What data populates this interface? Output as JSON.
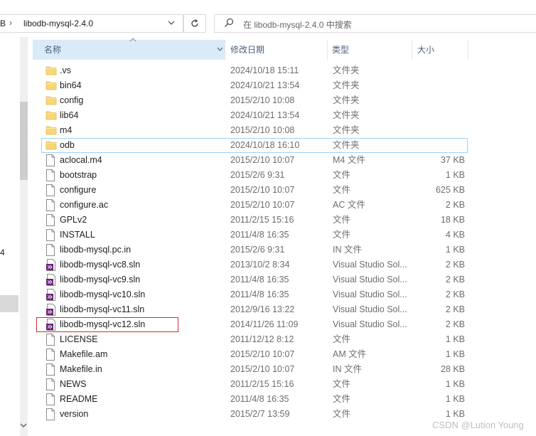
{
  "address": {
    "prev_crumb": "B",
    "separator": "›",
    "current_folder": "libodb-mysql-2.4.0",
    "dropdown_icon": "chevron-down-icon",
    "refresh_icon": "refresh-icon"
  },
  "search": {
    "placeholder": "在 libodb-mysql-2.4.0 中搜索",
    "icon": "search-icon"
  },
  "nav": {
    "partial_label": "4"
  },
  "columns": {
    "name": "名称",
    "date": "修改日期",
    "type": "类型",
    "size": "大小"
  },
  "colors": {
    "header_bg": "#d9ebf9",
    "folder": "#f8d775",
    "focus_border": "#99d1ff",
    "highlight_box": "#d62d2d"
  },
  "files": [
    {
      "name": ".vs",
      "date": "2024/10/18 15:11",
      "type": "文件夹",
      "size": "",
      "icon": "folder-icon"
    },
    {
      "name": "bin64",
      "date": "2024/10/21 13:54",
      "type": "文件夹",
      "size": "",
      "icon": "folder-icon"
    },
    {
      "name": "config",
      "date": "2015/2/10 10:08",
      "type": "文件夹",
      "size": "",
      "icon": "folder-icon"
    },
    {
      "name": "lib64",
      "date": "2024/10/21 13:54",
      "type": "文件夹",
      "size": "",
      "icon": "folder-icon"
    },
    {
      "name": "m4",
      "date": "2015/2/10 10:08",
      "type": "文件夹",
      "size": "",
      "icon": "folder-icon"
    },
    {
      "name": "odb",
      "date": "2024/10/18 16:10",
      "type": "文件夹",
      "size": "",
      "icon": "folder-icon",
      "focused": true
    },
    {
      "name": "aclocal.m4",
      "date": "2015/2/10 10:07",
      "type": "M4 文件",
      "size": "37 KB",
      "icon": "file-icon"
    },
    {
      "name": "bootstrap",
      "date": "2015/2/6 9:31",
      "type": "文件",
      "size": "1 KB",
      "icon": "file-icon"
    },
    {
      "name": "configure",
      "date": "2015/2/10 10:07",
      "type": "文件",
      "size": "625 KB",
      "icon": "file-icon"
    },
    {
      "name": "configure.ac",
      "date": "2015/2/10 10:07",
      "type": "AC 文件",
      "size": "2 KB",
      "icon": "file-icon"
    },
    {
      "name": "GPLv2",
      "date": "2011/2/15 15:16",
      "type": "文件",
      "size": "18 KB",
      "icon": "file-icon"
    },
    {
      "name": "INSTALL",
      "date": "2011/4/8 16:35",
      "type": "文件",
      "size": "4 KB",
      "icon": "file-icon"
    },
    {
      "name": "libodb-mysql.pc.in",
      "date": "2015/2/6 9:31",
      "type": "IN 文件",
      "size": "1 KB",
      "icon": "file-icon"
    },
    {
      "name": "libodb-mysql-vc8.sln",
      "date": "2013/10/2 8:34",
      "type": "Visual Studio Sol...",
      "size": "2 KB",
      "icon": "vs-sln-icon"
    },
    {
      "name": "libodb-mysql-vc9.sln",
      "date": "2011/4/8 16:35",
      "type": "Visual Studio Sol...",
      "size": "2 KB",
      "icon": "vs-sln-icon"
    },
    {
      "name": "libodb-mysql-vc10.sln",
      "date": "2011/4/8 16:35",
      "type": "Visual Studio Sol...",
      "size": "2 KB",
      "icon": "vs-sln-icon"
    },
    {
      "name": "libodb-mysql-vc11.sln",
      "date": "2012/9/16 13:22",
      "type": "Visual Studio Sol...",
      "size": "2 KB",
      "icon": "vs-sln-icon"
    },
    {
      "name": "libodb-mysql-vc12.sln",
      "date": "2014/11/26 11:09",
      "type": "Visual Studio Sol...",
      "size": "2 KB",
      "icon": "vs-sln-icon",
      "highlighted": true
    },
    {
      "name": "LICENSE",
      "date": "2011/12/12 8:12",
      "type": "文件",
      "size": "1 KB",
      "icon": "file-icon"
    },
    {
      "name": "Makefile.am",
      "date": "2015/2/10 10:07",
      "type": "AM 文件",
      "size": "1 KB",
      "icon": "file-icon"
    },
    {
      "name": "Makefile.in",
      "date": "2015/2/10 10:07",
      "type": "IN 文件",
      "size": "28 KB",
      "icon": "file-icon"
    },
    {
      "name": "NEWS",
      "date": "2011/2/15 15:16",
      "type": "文件",
      "size": "1 KB",
      "icon": "file-icon"
    },
    {
      "name": "README",
      "date": "2011/4/8 16:35",
      "type": "文件",
      "size": "1 KB",
      "icon": "file-icon"
    },
    {
      "name": "version",
      "date": "2015/2/7 13:59",
      "type": "文件",
      "size": "1 KB",
      "icon": "file-icon"
    }
  ],
  "watermark": "CSDN @Lution Young"
}
